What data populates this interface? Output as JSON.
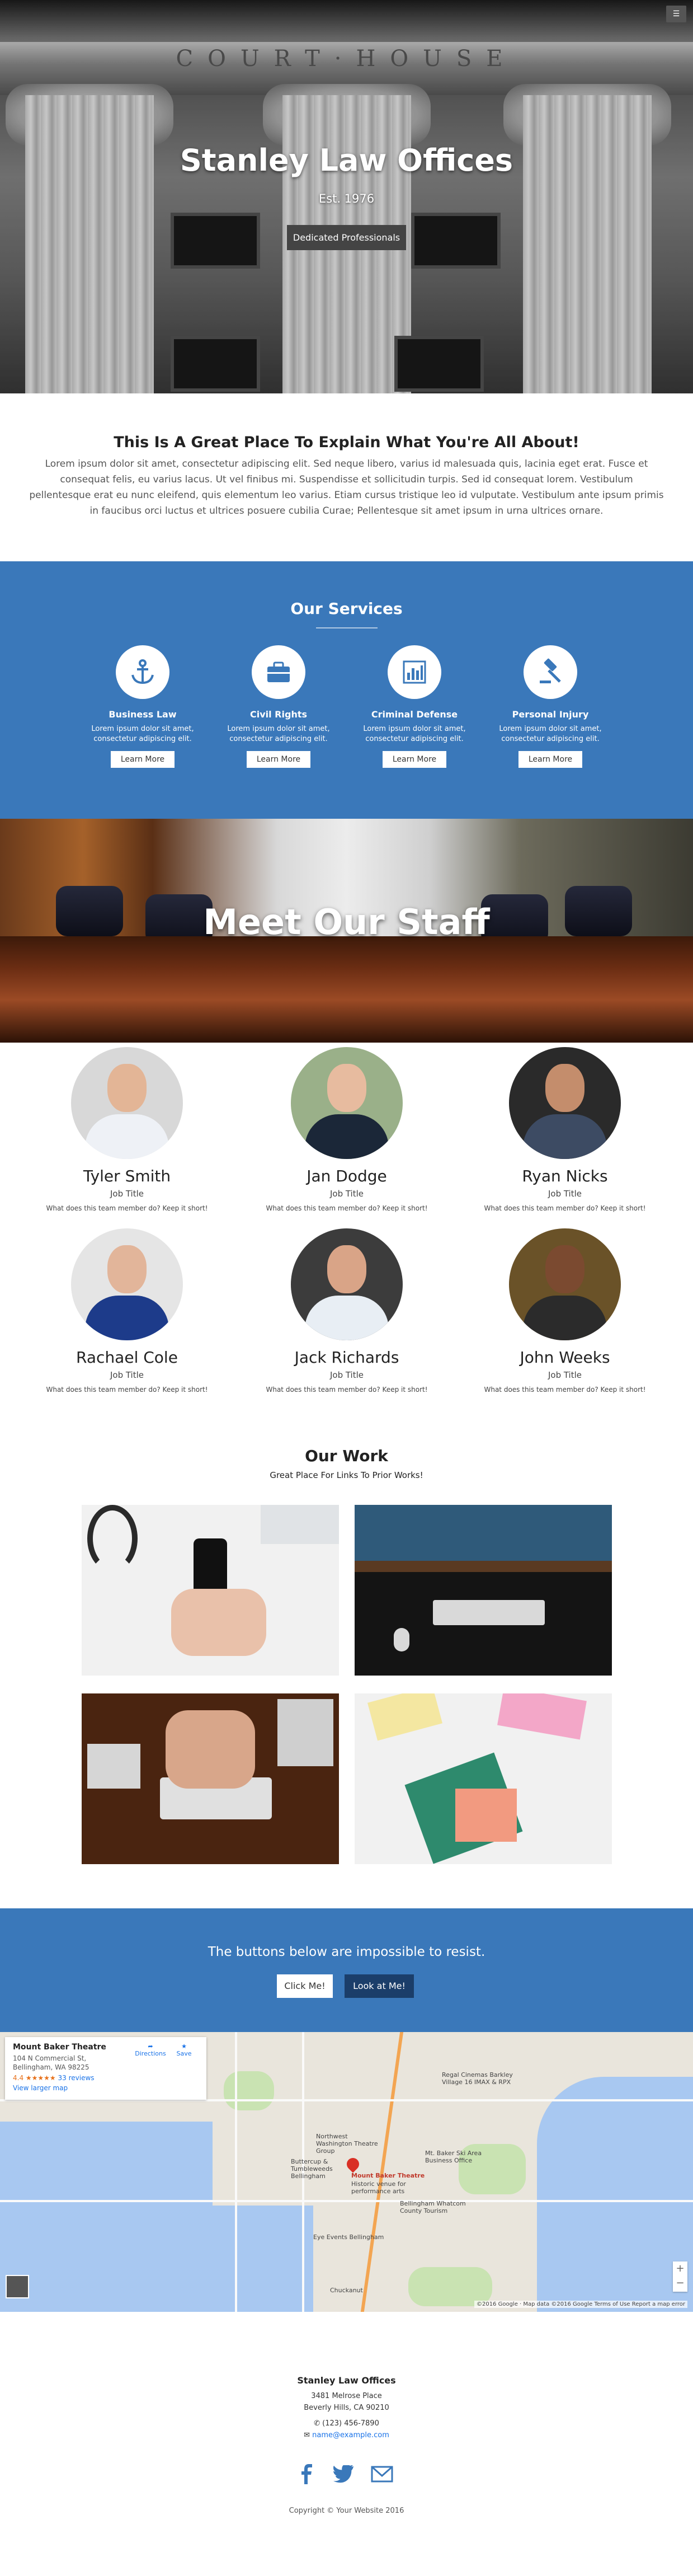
{
  "hero": {
    "frieze_text": "COURT·HOUSE",
    "menu_icon": "menu-icon",
    "title": "Stanley Law Offices",
    "subtitle": "Est. 1976",
    "button_label": "Dedicated Professionals"
  },
  "intro": {
    "title": "This Is A Great Place To Explain What You're All About!",
    "text": "Lorem ipsum dolor sit amet, consectetur adipiscing elit. Sed neque libero, varius id malesuada quis, lacinia eget erat. Fusce et consequat felis, eu varius lacus. Ut vel finibus mi. Suspendisse et sollicitudin turpis. Sed id consequat lorem. Vestibulum pellentesque erat eu nunc eleifend, quis elementum leo varius. Etiam cursus tristique leo id vulputate. Vestibulum ante ipsum primis in faucibus orci luctus et ultrices posuere cubilia Curae; Pellentesque sit amet ipsum in urna ultrices ornare."
  },
  "services": {
    "title": "Our Services",
    "items": [
      {
        "name": "Business Law",
        "desc": "Lorem ipsum dolor sit amet, consectetur adipiscing elit.",
        "button": "Learn More",
        "icon": "anchor-icon"
      },
      {
        "name": "Civil Rights",
        "desc": "Lorem ipsum dolor sit amet, consectetur adipiscing elit.",
        "button": "Learn More",
        "icon": "briefcase-icon"
      },
      {
        "name": "Criminal Defense",
        "desc": "Lorem ipsum dolor sit amet, consectetur adipiscing elit.",
        "button": "Learn More",
        "icon": "bar-chart-icon"
      },
      {
        "name": "Personal Injury",
        "desc": "Lorem ipsum dolor sit amet, consectetur adipiscing elit.",
        "button": "Learn More",
        "icon": "gavel-icon"
      }
    ],
    "color": "#3a78ba"
  },
  "staff": {
    "banner_title": "Meet Our Staff",
    "members": [
      {
        "name": "Tyler Smith",
        "title": "Job Title",
        "desc": "What does this team member do? Keep it short!"
      },
      {
        "name": "Jan Dodge",
        "title": "Job Title",
        "desc": "What does this team member do? Keep it short!"
      },
      {
        "name": "Ryan Nicks",
        "title": "Job Title",
        "desc": "What does this team member do? Keep it short!"
      },
      {
        "name": "Rachael Cole",
        "title": "Job Title",
        "desc": "What does this team member do? Keep it short!"
      },
      {
        "name": "Jack Richards",
        "title": "Job Title",
        "desc": "What does this team member do? Keep it short!"
      },
      {
        "name": "John Weeks",
        "title": "Job Title",
        "desc": "What does this team member do? Keep it short!"
      }
    ]
  },
  "work": {
    "title": "Our Work",
    "subtitle": "Great Place For Links To Prior Works!"
  },
  "cta": {
    "text": "The buttons below are impossible to resist.",
    "button1": "Click Me!",
    "button2": "Look at Me!"
  },
  "map": {
    "place_name": "Mount Baker Theatre",
    "address": "104 N Commercial St, Bellingham, WA 98225",
    "rating": "4.4 ★★★★★",
    "reviews": "33 reviews",
    "larger_map": "View larger map",
    "directions": "Directions",
    "save": "Save",
    "labels": {
      "theatre": "Mount Baker Theatre",
      "theatre_sub": "Historic venue for performance arts",
      "regal": "Regal Cinemas Barkley Village 16 IMAX & RPX",
      "nw_theatre": "Northwest Washington Theatre Group",
      "buttercup": "Buttercup & Tumbleweeds Bellingham",
      "baker_ski": "Mt. Baker Ski Area Business Office",
      "cheese": "Bellingham Whatcom County Tourism",
      "eye_events": "Eye Events Bellingham",
      "chuckanut": "Chuckanut",
      "footer": "©2016 Google · Map data ©2016 Google   Terms of Use   Report a map error"
    }
  },
  "footer": {
    "name": "Stanley Law Offices",
    "street": "3481 Melrose Place",
    "city": "Beverly Hills, CA 90210",
    "phone": "(123) 456-7890",
    "email": "name@example.com",
    "copyright": "Copyright © Your Website 2016"
  }
}
